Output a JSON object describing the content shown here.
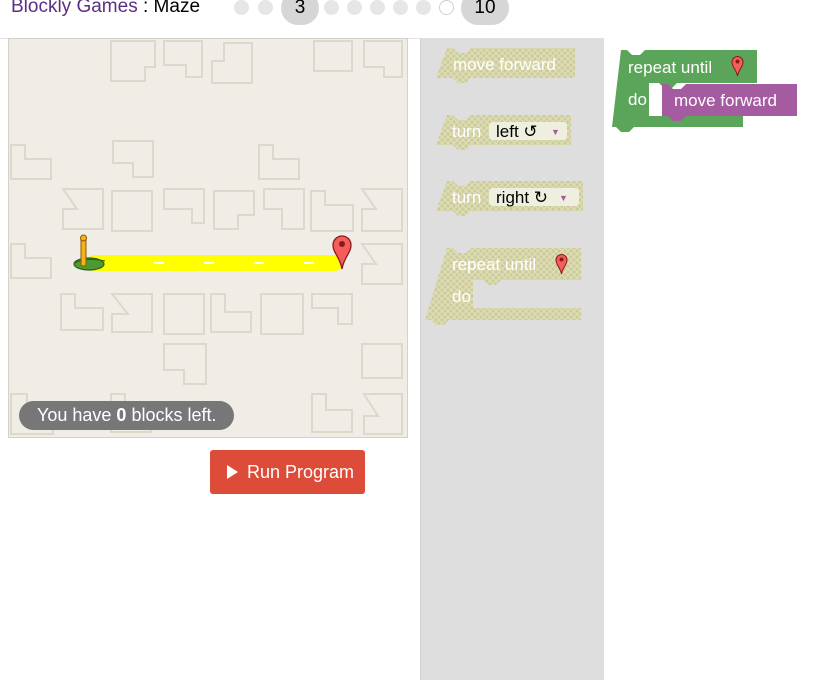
{
  "header": {
    "brand": "Blockly Games",
    "separator": " : ",
    "game": "Maze",
    "current_level": "3",
    "last_level": "10"
  },
  "maze": {
    "capacity_prefix": "You have ",
    "capacity_count": "0",
    "capacity_suffix": " blocks left."
  },
  "run_button": {
    "label": "Run Program"
  },
  "toolbox": {
    "move_forward": "move forward",
    "turn_left": {
      "label": "turn",
      "option": "left ↺"
    },
    "turn_right": {
      "label": "turn",
      "option": "right ↻"
    },
    "repeat_until": {
      "label": "repeat until",
      "do": "do"
    }
  },
  "workspace": {
    "repeat_until": {
      "label": "repeat until",
      "do": "do"
    },
    "inner_block": "move forward"
  },
  "colors": {
    "movement": "#a55b9f",
    "loop": "#5ba55b",
    "path": "#ffff00",
    "run": "#dd4b39"
  }
}
